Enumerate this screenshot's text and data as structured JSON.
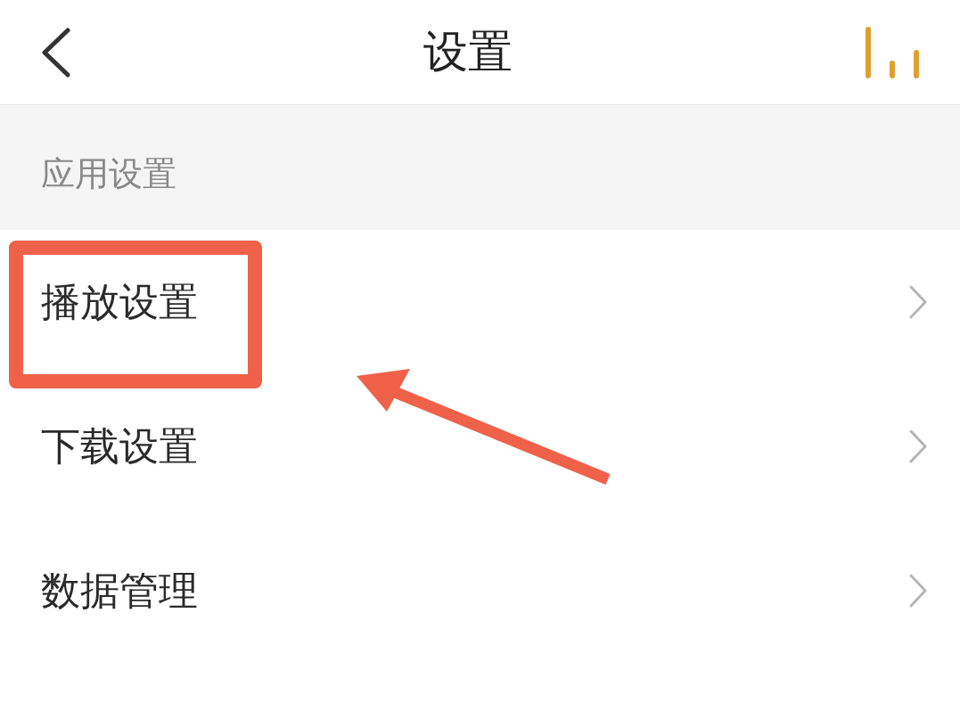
{
  "header": {
    "title": "设置"
  },
  "section": {
    "title": "应用设置"
  },
  "items": [
    {
      "label": "播放设置",
      "highlighted": true
    },
    {
      "label": "下载设置",
      "highlighted": false
    },
    {
      "label": "数据管理",
      "highlighted": false
    }
  ]
}
